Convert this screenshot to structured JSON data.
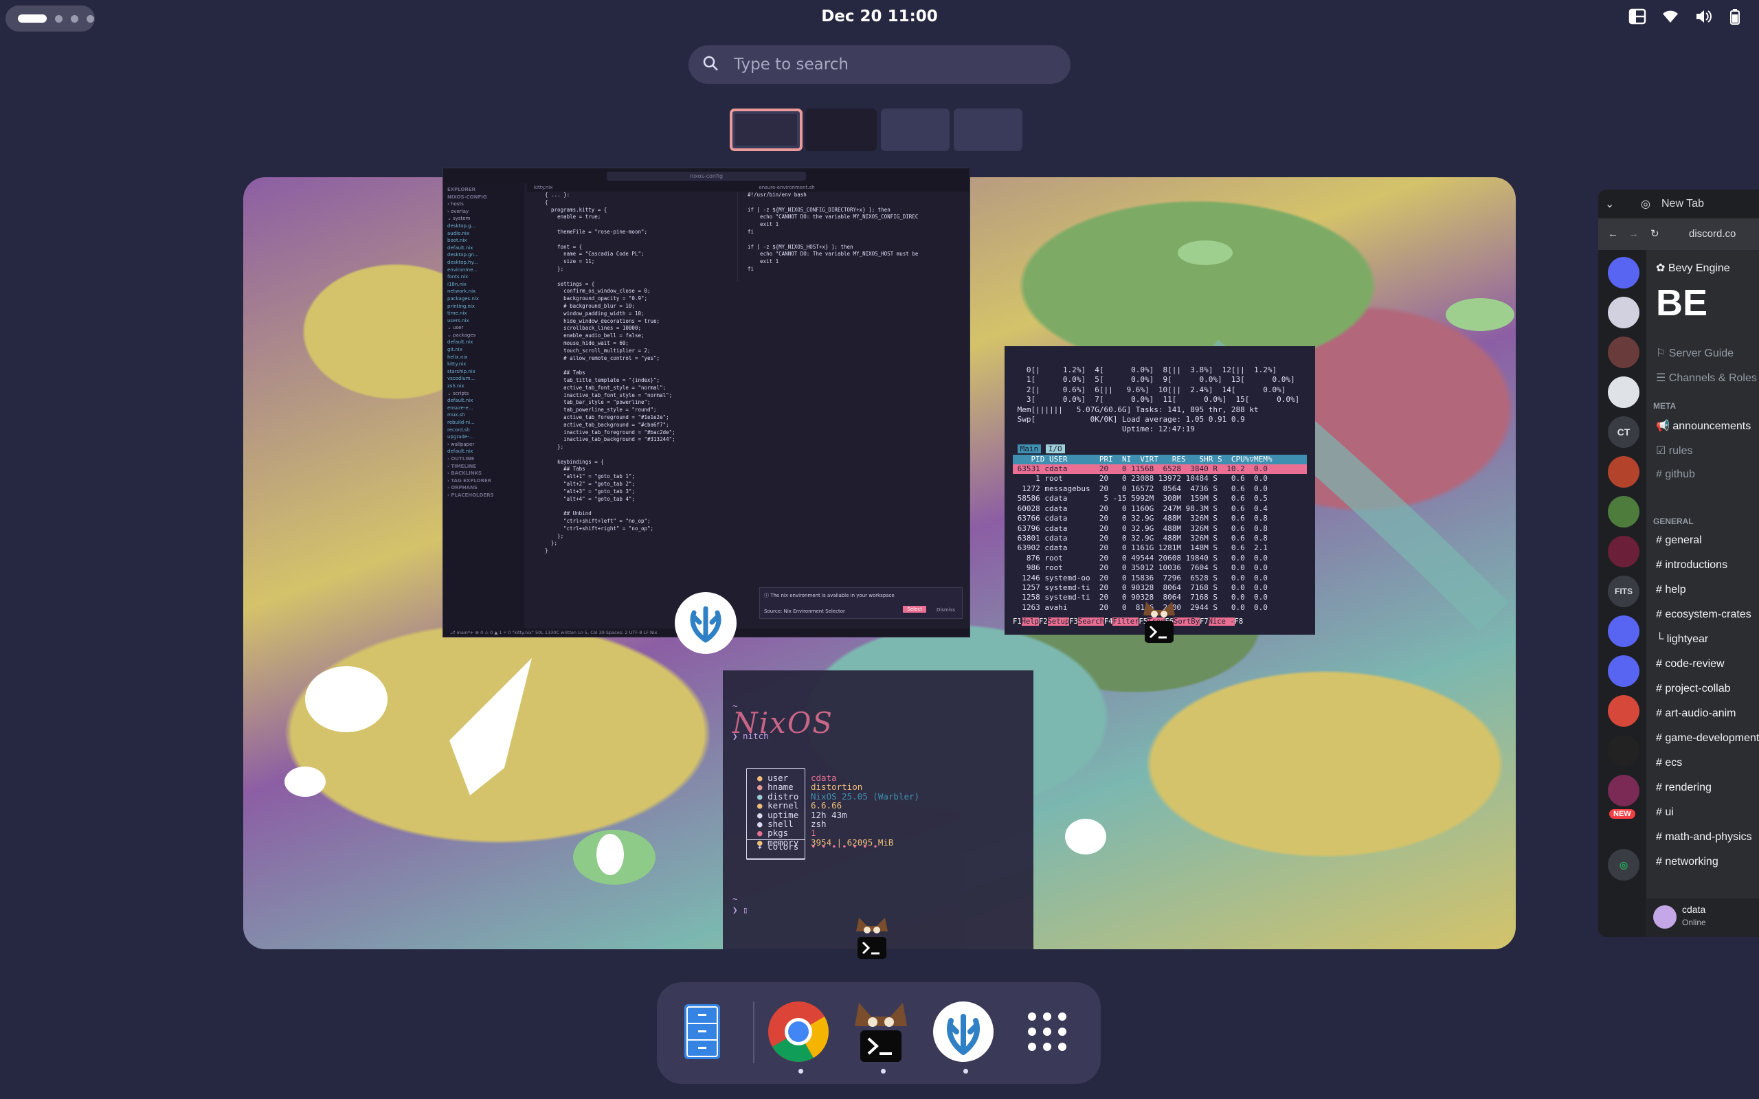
{
  "topbar": {
    "clock": "Dec 20  11:00"
  },
  "search": {
    "placeholder": "Type to search"
  },
  "vscode": {
    "title": "nixos-config",
    "tab1": "kitty.nix",
    "tab2": "ensure-environment.sh",
    "sidebar": [
      {
        "t": "EXPLORER",
        "c": "sec"
      },
      {
        "t": "NIXOS-CONFIG",
        "c": "sec"
      },
      {
        "t": "› hosts"
      },
      {
        "t": "› overlay"
      },
      {
        "t": "⌄ system"
      },
      {
        "t": "  desktop.g...",
        "c": "f"
      },
      {
        "t": "  audio.nix",
        "c": "f"
      },
      {
        "t": "  boot.nix",
        "c": "f"
      },
      {
        "t": "  default.nix",
        "c": "f"
      },
      {
        "t": "  desktop.gn...",
        "c": "f"
      },
      {
        "t": "  desktop.hy...",
        "c": "f"
      },
      {
        "t": "  environme...",
        "c": "f"
      },
      {
        "t": "  fonts.nix",
        "c": "f"
      },
      {
        "t": "  i18n.nix",
        "c": "f"
      },
      {
        "t": "  network.nix",
        "c": "f"
      },
      {
        "t": "  packages.nix",
        "c": "f"
      },
      {
        "t": "  printing.nix",
        "c": "f"
      },
      {
        "t": "  time.nix",
        "c": "f"
      },
      {
        "t": "  users.nix",
        "c": "f"
      },
      {
        "t": "⌄ user"
      },
      {
        "t": "  ⌄ packages"
      },
      {
        "t": "    default.nix",
        "c": "f"
      },
      {
        "t": "    git.nix",
        "c": "f"
      },
      {
        "t": "    helix.nix",
        "c": "f"
      },
      {
        "t": "    kitty.nix",
        "c": "f"
      },
      {
        "t": "    starship.nix",
        "c": "f"
      },
      {
        "t": "    vscodium...",
        "c": "f"
      },
      {
        "t": "    zsh.nix",
        "c": "f"
      },
      {
        "t": "  ⌄ scripts"
      },
      {
        "t": "    default.nix",
        "c": "f"
      },
      {
        "t": "    ensure-e...",
        "c": "f"
      },
      {
        "t": "    mux.sh",
        "c": "f"
      },
      {
        "t": "    rebuild-ni...",
        "c": "f"
      },
      {
        "t": "    record.sh",
        "c": "f"
      },
      {
        "t": "    upgrade-...",
        "c": "f"
      },
      {
        "t": "  › wallpaper"
      },
      {
        "t": "    default.nix",
        "c": "f"
      },
      {
        "t": "› OUTLINE",
        "c": "sec"
      },
      {
        "t": "› TIMELINE",
        "c": "sec"
      },
      {
        "t": "› BACKLINKS",
        "c": "sec"
      },
      {
        "t": "› TAG EXPLORER",
        "c": "sec"
      },
      {
        "t": "› ORPHANS",
        "c": "sec"
      },
      {
        "t": "› PLACEHOLDERS",
        "c": "sec"
      }
    ],
    "code1": "{ ... }:\n{\n  programs.kitty = {\n    enable = true;\n\n    themeFile = \"rose-pine-moon\";\n\n    font = {\n      name = \"Cascadia Code PL\";\n      size = 11;\n    };\n\n    settings = {\n      confirm_os_window_close = 0;\n      background_opacity = \"0.9\";\n      # background_blur = 10;\n      window_padding_width = 10;\n      hide_window_decorations = true;\n      scrollback_lines = 10000;\n      enable_audio_bell = false;\n      mouse_hide_wait = 60;\n      touch_scroll_multiplier = 2;\n      # allow_remote_control = \"yes\";\n\n      ## Tabs\n      tab_title_template = \"{index}\";\n      active_tab_font_style = \"normal\";\n      inactive_tab_font_style = \"normal\";\n      tab_bar_style = \"powerline\";\n      tab_powerline_style = \"round\";\n      active_tab_foreground = \"#1e1e2e\";\n      active_tab_background = \"#cba6f7\";\n      inactive_tab_foreground = \"#bac2de\";\n      inactive_tab_background = \"#313244\";\n    };\n\n    keybindings = {\n      ## Tabs\n      \"alt+1\" = \"goto_tab 1\";\n      \"alt+2\" = \"goto_tab 2\";\n      \"alt+3\" = \"goto_tab 3\";\n      \"alt+4\" = \"goto_tab 4\";\n\n      ## Unbind\n      \"ctrl+shift+left\" = \"no_op\";\n      \"ctrl+shift+right\" = \"no_op\";\n    };\n  };\n}",
    "code2": "#!/usr/bin/env bash\n\nif [ -z ${MY_NIXOS_CONFIG_DIRECTORY+x} ]; then\n    echo \"CANNOT DO: the variable MY_NIXOS_CONFIG_DIREC\n    exit 1\nfi\n\nif [ -z ${MY_NIXOS_HOST+x} ]; then\n    echo \"CANNOT DO: The variable MY_NIXOS_HOST must be\n    exit 1\nfi",
    "notif_msg": "ⓘ  The nix environment is available in your workspace",
    "notif_src": "Source: Nix Environment Selector",
    "notif_select": "Select",
    "notif_dismiss": "Dismiss",
    "status": "⎇ main*+  ⊗ 0 ⚠ 0 ▲ 1    ⚡ 0   \"kitty.nix\" 50L 1330C written                                   Ln 5, Col 39   Spaces: 2   UTF-8   LF   Nix"
  },
  "htop": {
    "meters": "   0[|     1.2%]  4[      0.0%]  8[||  3.8%]  12[||  1.2%]\n   1[      0.0%]  5[      0.0%]  9[      0.0%]  13[      0.0%]\n   2[|     0.6%]  6[||   9.6%]  10[||  2.4%]  14[      0.0%]\n   3[      0.0%]  7[      0.0%]  11[      0.0%]  15[      0.0%]\n Mem[||||||   5.07G/60.6G] Tasks: 141, 895 thr, 288 kt\n Swp[            0K/0K] Load average: 1.05 0.91 0.9\n                        Uptime: 12:47:19",
    "tab_main": "Main",
    "tab_io": "I/O",
    "header": "    PID USER       PRI  NI  VIRT   RES   SHR S  CPU%▽MEM%",
    "selected": " 63531 cdata       20   0 11568  6528  3840 R  10.2  0.0",
    "rows": "     1 root        20   0 23088 13972 10484 S   0.6  0.0\n  1272 messagebus  20   0 16572  8564  4736 S   0.6  0.0\n 58586 cdata        5 -15 5992M  308M  159M S   0.6  0.5\n 60028 cdata       20   0 1160G  247M 98.3M S   0.6  0.4\n 63766 cdata       20   0 32.9G  488M  326M S   0.6  0.8\n 63796 cdata       20   0 32.9G  488M  326M S   0.6  0.8\n 63801 cdata       20   0 32.9G  488M  326M S   0.6  0.8\n 63902 cdata       20   0 1161G 1281M  148M S   0.6  2.1\n   876 root        20   0 49544 20608 19840 S   0.0  0.0\n   986 root        20   0 35012 10036  7604 S   0.0  0.0\n  1246 systemd-oo  20   0 15836  7296  6528 S   0.0  0.0\n  1257 systemd-ti  20   0 90328  8064  7168 S   0.0  0.0\n  1258 systemd-ti  20   0 90328  8064  7168 S   0.0  0.0\n  1263 avahi       20   0  8116  2600  2944 S   0.0  0.0",
    "fkeys": [
      [
        "F1",
        "Help"
      ],
      [
        "F2",
        "Setup"
      ],
      [
        "F3",
        "Search"
      ],
      [
        "F4",
        "Filter"
      ],
      [
        "F5",
        "Tree"
      ],
      [
        "F6",
        "SortBy"
      ],
      [
        "F7",
        "Nice -"
      ],
      [
        "F8",
        ""
      ]
    ]
  },
  "terminal": {
    "prompt1": "~",
    "cmd": "❯ nitch",
    "logo": "NixOS",
    "keys": [
      "user",
      "hname",
      "distro",
      "kernel",
      "uptime",
      "shell",
      "pkgs",
      "memory"
    ],
    "vals": [
      "cdata",
      "distortion",
      "NixOS 25.05 (Warbler)",
      "6.6.66",
      "12h 43m",
      "zsh",
      "1",
      "3954 | 62095 MiB"
    ],
    "colors_label": "colors",
    "colors_dots": "• • • • • • •",
    "prompt2": "~",
    "cursor": "❯ ▯"
  },
  "peek": {
    "tab": "New Tab",
    "url": "discord.co",
    "server": "Bevy Engine",
    "banner": "BE",
    "items": [
      "Server Guide",
      "Channels & Roles"
    ],
    "cat_meta": "META",
    "meta": [
      "announcements",
      "rules",
      "github"
    ],
    "cat_general": "GENERAL",
    "general": [
      "general",
      "introductions",
      "help",
      "ecosystem-crates",
      "lightyear",
      "code-review",
      "project-collab",
      "art-audio-anim",
      "game-development",
      "ecs",
      "rendering",
      "ui",
      "math-and-physics",
      "networking"
    ],
    "user": "cdata",
    "user_status": "Online",
    "servers": [
      "CT",
      "FITS"
    ],
    "new_badge": "NEW"
  },
  "colors": {
    "accent": "#ea9a97",
    "bg": "#262740"
  }
}
